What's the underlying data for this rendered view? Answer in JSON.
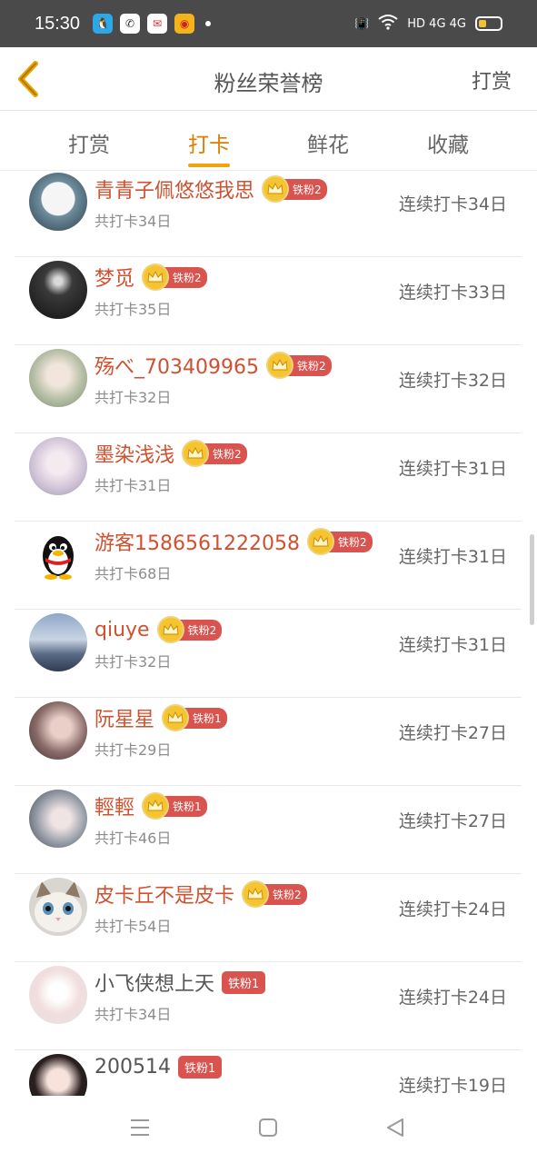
{
  "status": {
    "time": "15:30",
    "network": "HD 4G 4G"
  },
  "header": {
    "title": "粉丝荣誉榜",
    "action": "打赏"
  },
  "tabs": [
    {
      "label": "打赏",
      "active": false
    },
    {
      "label": "打卡",
      "active": true
    },
    {
      "label": "鲜花",
      "active": false
    },
    {
      "label": "收藏",
      "active": false
    }
  ],
  "rows": [
    {
      "name": "青青子佩悠悠我思",
      "badge": "铁粉2",
      "crown": true,
      "total": "共打卡34日",
      "streak": "连续打卡34日"
    },
    {
      "name": "梦觅",
      "badge": "铁粉2",
      "crown": true,
      "total": "共打卡35日",
      "streak": "连续打卡33日"
    },
    {
      "name": "殇べ_703409965",
      "badge": "铁粉2",
      "crown": true,
      "total": "共打卡32日",
      "streak": "连续打卡32日"
    },
    {
      "name": "墨染浅浅",
      "badge": "铁粉2",
      "crown": true,
      "total": "共打卡31日",
      "streak": "连续打卡31日"
    },
    {
      "name": "游客1586561222058",
      "badge": "铁粉2",
      "crown": true,
      "total": "共打卡68日",
      "streak": "连续打卡31日"
    },
    {
      "name": "qiuye",
      "badge": "铁粉2",
      "crown": true,
      "total": "共打卡32日",
      "streak": "连续打卡31日"
    },
    {
      "name": "阮星星",
      "badge": "铁粉1",
      "crown": true,
      "total": "共打卡29日",
      "streak": "连续打卡27日"
    },
    {
      "name": "輕輕",
      "badge": "铁粉1",
      "crown": true,
      "total": "共打卡46日",
      "streak": "连续打卡27日"
    },
    {
      "name": "皮卡丘不是皮卡",
      "badge": "铁粉2",
      "crown": true,
      "total": "共打卡54日",
      "streak": "连续打卡24日"
    },
    {
      "name": "小飞侠想上天",
      "badge": "铁粉1",
      "crown": false,
      "total": "共打卡34日",
      "streak": "连续打卡24日"
    },
    {
      "name": "200514",
      "badge": "铁粉1",
      "crown": false,
      "total": "",
      "streak": "连续打卡19日"
    }
  ],
  "colors": {
    "accent": "#f1a20f",
    "name": "#d0512f",
    "badge": "#d9534f"
  }
}
